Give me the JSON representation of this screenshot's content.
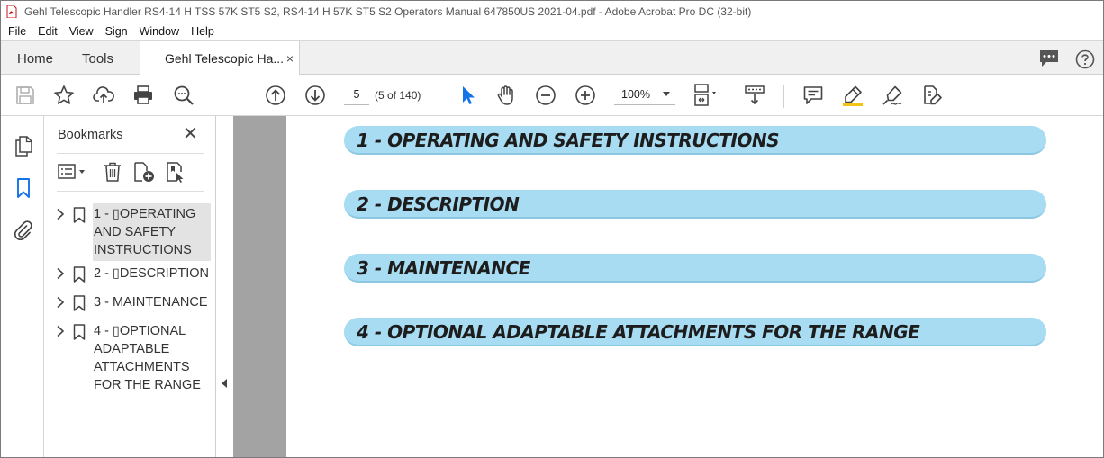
{
  "window": {
    "title": "Gehl Telescopic Handler RS4-14 H TSS 57K ST5 S2, RS4-14 H 57K ST5 S2 Operators Manual 647850US 2021-04.pdf - Adobe Acrobat Pro DC (32-bit)"
  },
  "menu": [
    "File",
    "Edit",
    "View",
    "Sign",
    "Window",
    "Help"
  ],
  "tabs": {
    "home": "Home",
    "tools": "Tools",
    "document": "Gehl Telescopic Ha...",
    "close": "×"
  },
  "toolbar": {
    "page_number": "5",
    "page_count": "(5 of 140)",
    "zoom": "100%"
  },
  "bookmarks_panel": {
    "title": "Bookmarks",
    "close": "✕",
    "items": [
      {
        "label": "1 - ▯OPERATING AND SAFETY INSTRUCTIONS",
        "selected": true
      },
      {
        "label": "2 - ▯DESCRIPTION",
        "selected": false
      },
      {
        "label": "3 - MAINTENANCE",
        "selected": false
      },
      {
        "label": "4 - ▯OPTIONAL ADAPTABLE ATTACHMENTS FOR THE RANGE",
        "selected": false
      }
    ]
  },
  "document": {
    "sections": [
      "1 - OPERATING AND SAFETY INSTRUCTIONS",
      "2 - DESCRIPTION",
      "3 - MAINTENANCE",
      "4 - OPTIONAL ADAPTABLE ATTACHMENTS FOR THE RANGE"
    ]
  },
  "colors": {
    "accent": "#1473e6",
    "section_pill": "#a7dcf3",
    "doc_background": "#a3a3a3"
  },
  "icons": {
    "toolbar": [
      "save-icon",
      "star-icon",
      "upload-icon",
      "print-icon",
      "zoom-search-icon",
      "page-up-icon",
      "page-down-icon",
      "select-cursor-icon",
      "hand-icon",
      "zoom-out-icon",
      "zoom-in-icon",
      "page-layout-icon",
      "scroll-mode-icon",
      "comment-icon",
      "highlight-icon",
      "sign-icon",
      "edit-pdf-icon"
    ],
    "rail": [
      "pages-icon",
      "bookmark-icon",
      "attachment-icon"
    ]
  }
}
